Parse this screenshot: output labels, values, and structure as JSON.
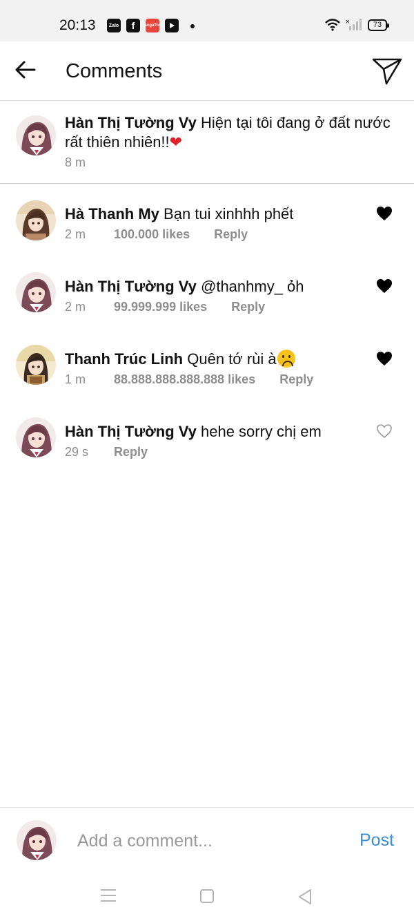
{
  "status_bar": {
    "time": "20:13",
    "apps": [
      "Zalo",
      "Facebook",
      "MangaToon",
      "YouTube"
    ],
    "battery": "73"
  },
  "header": {
    "title": "Comments",
    "back_icon": "arrow-left-icon",
    "send_icon": "paper-plane-icon"
  },
  "caption": {
    "username": "Hàn Thị Tường Vy",
    "text": "Hiện tại tôi đang ở đất nước rất thiên nhiên!!",
    "emoji": "❤️",
    "time": "8 m"
  },
  "comments": [
    {
      "username": "Hà Thanh My",
      "text": "Bạn tui xinhhh phết",
      "time": "2 m",
      "likes": "100.000 likes",
      "reply": "Reply",
      "liked": true
    },
    {
      "username": "Hàn Thị Tường Vy",
      "text": "@thanhmy_ ỏh",
      "time": "2 m",
      "likes": "99.999.999 likes",
      "reply": "Reply",
      "liked": true
    },
    {
      "username": "Thanh Trúc Linh",
      "text": "Quên tớ rùi à",
      "emoji": "☹️",
      "time": "1 m",
      "likes": "88.888.888.888.888 likes",
      "reply": "Reply",
      "liked": true
    },
    {
      "username": "Hàn Thị Tường Vy",
      "text": "hehe sorry chị em",
      "time": "29 s",
      "reply": "Reply",
      "liked": false
    }
  ],
  "comment_bar": {
    "placeholder": "Add a comment...",
    "post_label": "Post"
  },
  "colors": {
    "accent": "#3b8fd6",
    "meta_text": "#8e8e8e",
    "heart": "#e0202a"
  }
}
